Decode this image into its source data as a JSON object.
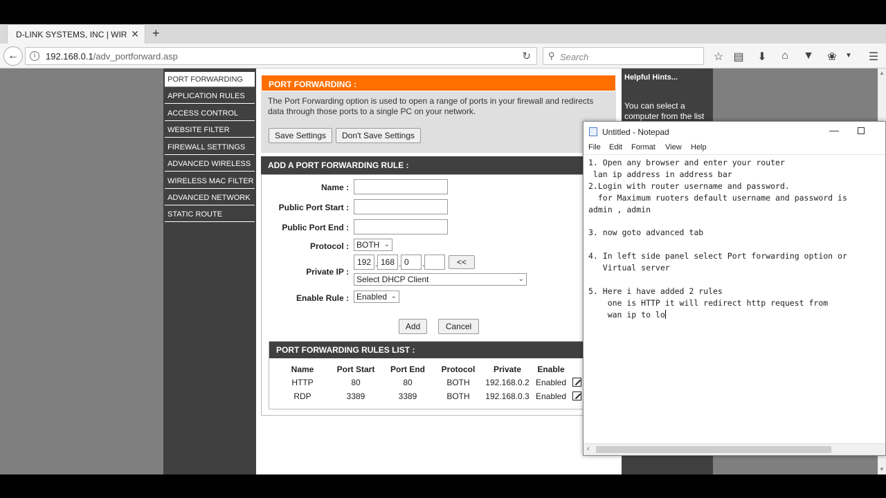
{
  "browser": {
    "tab_title": "D-LINK SYSTEMS, INC | WIREL...",
    "tab_close": "✕",
    "new_tab": "+",
    "url_host": "192.168.0.1",
    "url_path": "/adv_portforward.asp",
    "search_placeholder": "Search"
  },
  "leftnav": {
    "items": [
      {
        "label": "PORT FORWARDING"
      },
      {
        "label": "APPLICATION RULES"
      },
      {
        "label": "ACCESS CONTROL"
      },
      {
        "label": "WEBSITE FILTER"
      },
      {
        "label": "FIREWALL SETTINGS"
      },
      {
        "label": "ADVANCED WIRELESS"
      },
      {
        "label": "WIRELESS MAC FILTER"
      },
      {
        "label": "ADVANCED NETWORK"
      },
      {
        "label": "STATIC ROUTE"
      }
    ]
  },
  "port_forwarding": {
    "title": "PORT FORWARDING :",
    "description": "The Port Forwarding option is used to open a range of ports in your firewall and redirects data through those ports to a single PC on your network.",
    "save_label": "Save Settings",
    "dont_save_label": "Don't Save Settings"
  },
  "add_rule": {
    "title": "ADD A PORT FORWARDING RULE :",
    "name_label": "Name :",
    "public_start_label": "Public Port Start :",
    "public_end_label": "Public Port End :",
    "protocol_label": "Protocol :",
    "protocol_value": "BOTH",
    "private_ip_label": "Private IP :",
    "ip_octet_1": "192",
    "ip_octet_2": "168",
    "ip_octet_3": "0",
    "ip_octet_4": "",
    "ip_copy_label": "<<",
    "dhcp_select_value": "Select DHCP Client",
    "enable_rule_label": "Enable Rule :",
    "enable_rule_value": "Enabled",
    "add_label": "Add",
    "cancel_label": "Cancel"
  },
  "rules_list": {
    "title": "PORT FORWARDING RULES LIST :",
    "headers": [
      "Name",
      "Port Start",
      "Port End",
      "Protocol",
      "Private",
      "Enable"
    ],
    "rows": [
      [
        "HTTP",
        "80",
        "80",
        "BOTH",
        "192.168.0.2",
        "Enabled"
      ],
      [
        "RDP",
        "3389",
        "3389",
        "BOTH",
        "192.168.0.3",
        "Enabled"
      ]
    ]
  },
  "hints": {
    "title": "Helpful Hints...",
    "text": "You can select a computer from the list"
  },
  "notepad": {
    "title": "Untitled - Notepad",
    "menus": [
      "File",
      "Edit",
      "Format",
      "View",
      "Help"
    ],
    "content": "1. Open any browser and enter your router\n lan ip address in address bar\n2.Login with router username and password.\n  for Maximum ruoters default username and password is\nadmin , admin\n\n3. now goto advanced tab\n\n4. In left side panel select Port forwarding option or\n   Virtual server\n\n5. Here i have added 2 rules\n    one is HTTP it will redirect http request from\n    wan ip to lo"
  }
}
